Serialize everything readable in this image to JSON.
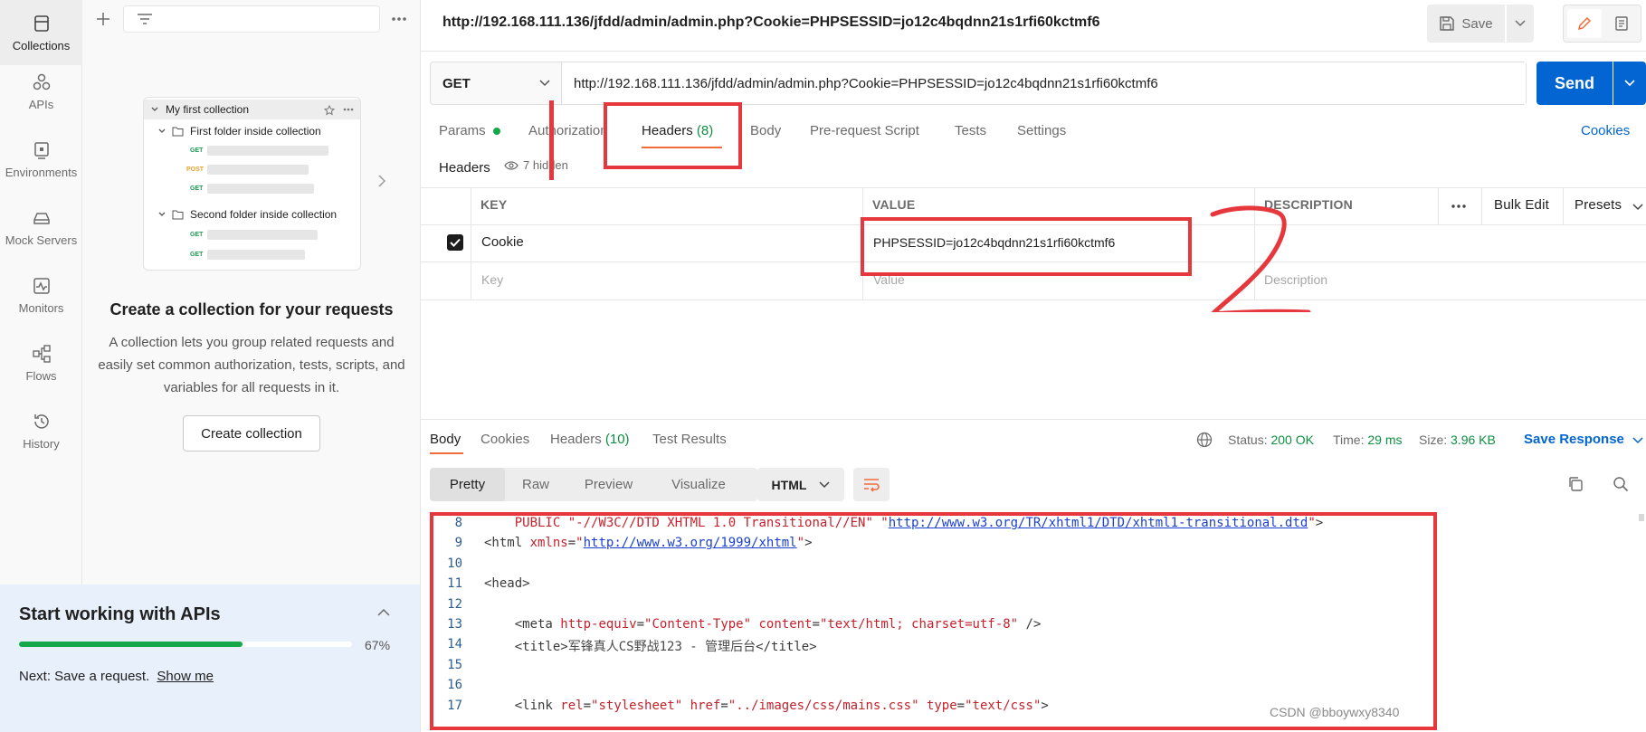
{
  "rail": [
    {
      "label": "Collections",
      "icon": "collections-icon"
    },
    {
      "label": "APIs",
      "icon": "apis-icon"
    },
    {
      "label": "Environments",
      "icon": "environments-icon"
    },
    {
      "label": "Mock Servers",
      "icon": "mock-servers-icon"
    },
    {
      "label": "Monitors",
      "icon": "monitors-icon"
    },
    {
      "label": "Flows",
      "icon": "flows-icon"
    },
    {
      "label": "History",
      "icon": "history-icon"
    }
  ],
  "sidebar": {
    "preview": {
      "collection": "My first collection",
      "folder1": "First folder inside collection",
      "folder2": "Second folder inside collection",
      "methods": [
        "GET",
        "POST",
        "GET",
        "GET",
        "GET"
      ]
    },
    "title": "Create a collection for your requests",
    "description": "A collection lets you group related requests and easily set common authorization, tests, scripts, and variables for all requests in it.",
    "create_button": "Create collection"
  },
  "start_panel": {
    "title": "Start working with APIs",
    "progress": 0.67,
    "progress_label": "67%",
    "next_prefix": "Next: Save a request.",
    "next_link": "Show me"
  },
  "request": {
    "tab_title": "http://192.168.111.136/jfdd/admin/admin.php?Cookie=PHPSESSID=jo12c4bqdnn21s1rfi60kctmf6",
    "save_label": "Save",
    "method": "GET",
    "url": "http://192.168.111.136/jfdd/admin/admin.php?Cookie=PHPSESSID=jo12c4bqdnn21s1rfi60kctmf6",
    "send_label": "Send",
    "tabs": {
      "params": "Params",
      "authorization": "Authorization",
      "headers": "Headers",
      "headers_count": "(8)",
      "body": "Body",
      "prerequest": "Pre-request Script",
      "tests": "Tests",
      "settings": "Settings"
    },
    "cookies_link": "Cookies",
    "headers_label": "Headers",
    "hidden_label": "7 hidden"
  },
  "headers_table": {
    "columns": {
      "key": "KEY",
      "value": "VALUE",
      "description": "DESCRIPTION"
    },
    "bulk_edit": "Bulk Edit",
    "presets": "Presets",
    "rows": [
      {
        "checked": true,
        "key": "Cookie",
        "value": "PHPSESSID=jo12c4bqdnn21s1rfi60kctmf6",
        "description": ""
      }
    ],
    "placeholders": {
      "key": "Key",
      "value": "Value",
      "description": "Description"
    }
  },
  "response": {
    "tabs": {
      "body": "Body",
      "cookies": "Cookies",
      "headers": "Headers",
      "headers_count": "(10)",
      "tests": "Test Results"
    },
    "status_label": "Status:",
    "status": "200 OK",
    "time_label": "Time:",
    "time": "29 ms",
    "size_label": "Size:",
    "size": "3.96 KB",
    "save_response": "Save Response",
    "views": [
      "Pretty",
      "Raw",
      "Preview",
      "Visualize"
    ],
    "language": "HTML"
  },
  "code_lines": [
    {
      "n": "8",
      "parts": [
        [
          "",
          "    "
        ],
        [
          "kw",
          "PUBLIC \"-//W3C//DTD XHTML 1.0 Transitional//EN\" \""
        ],
        [
          "lnk",
          "http://www.w3.org/TR/xhtml1/DTD/xhtml1-transitional.dtd"
        ],
        [
          "kw",
          "\""
        ],
        [
          "tg",
          ">"
        ]
      ]
    },
    {
      "n": "9",
      "parts": [
        [
          "tg",
          "<html "
        ],
        [
          "at",
          "xmlns"
        ],
        [
          "tg",
          "="
        ],
        [
          "sv",
          "\""
        ],
        [
          "lnk",
          "http://www.w3.org/1999/xhtml"
        ],
        [
          "sv",
          "\""
        ],
        [
          "tg",
          ">"
        ]
      ]
    },
    {
      "n": "10",
      "parts": [
        [
          "",
          ""
        ]
      ]
    },
    {
      "n": "11",
      "parts": [
        [
          "tg",
          "<head>"
        ]
      ]
    },
    {
      "n": "12",
      "parts": [
        [
          "",
          ""
        ]
      ]
    },
    {
      "n": "13",
      "parts": [
        [
          "",
          "    "
        ],
        [
          "tg",
          "<meta "
        ],
        [
          "at",
          "http-equiv"
        ],
        [
          "tg",
          "="
        ],
        [
          "sv",
          "\"Content-Type\""
        ],
        [
          "tg",
          " "
        ],
        [
          "at",
          "content"
        ],
        [
          "tg",
          "="
        ],
        [
          "sv",
          "\"text/html; charset=utf-8\""
        ],
        [
          "tg",
          " />"
        ]
      ]
    },
    {
      "n": "14",
      "parts": [
        [
          "",
          "    "
        ],
        [
          "tg",
          "<title>"
        ],
        [
          "",
          "军锋真人CS野战123 - 管理后台"
        ],
        [
          "tg",
          "</title>"
        ]
      ]
    },
    {
      "n": "15",
      "parts": [
        [
          "",
          ""
        ]
      ]
    },
    {
      "n": "16",
      "parts": [
        [
          "",
          ""
        ]
      ]
    },
    {
      "n": "17",
      "parts": [
        [
          "",
          "    "
        ],
        [
          "tg",
          "<link "
        ],
        [
          "at",
          "rel"
        ],
        [
          "tg",
          "="
        ],
        [
          "sv",
          "\"stylesheet\""
        ],
        [
          "tg",
          " "
        ],
        [
          "at",
          "href"
        ],
        [
          "tg",
          "="
        ],
        [
          "sv",
          "\"../images/css/mains.css\""
        ],
        [
          "tg",
          " "
        ],
        [
          "at",
          "type"
        ],
        [
          "tg",
          "="
        ],
        [
          "sv",
          "\"text/css\""
        ],
        [
          "tg",
          ">"
        ]
      ]
    }
  ],
  "watermark": "CSDN @bboywxy8340",
  "colors": {
    "accent": "#f26b3a",
    "primary": "#0265d2",
    "success": "#0d8f40",
    "annotation": "#e5373c"
  }
}
